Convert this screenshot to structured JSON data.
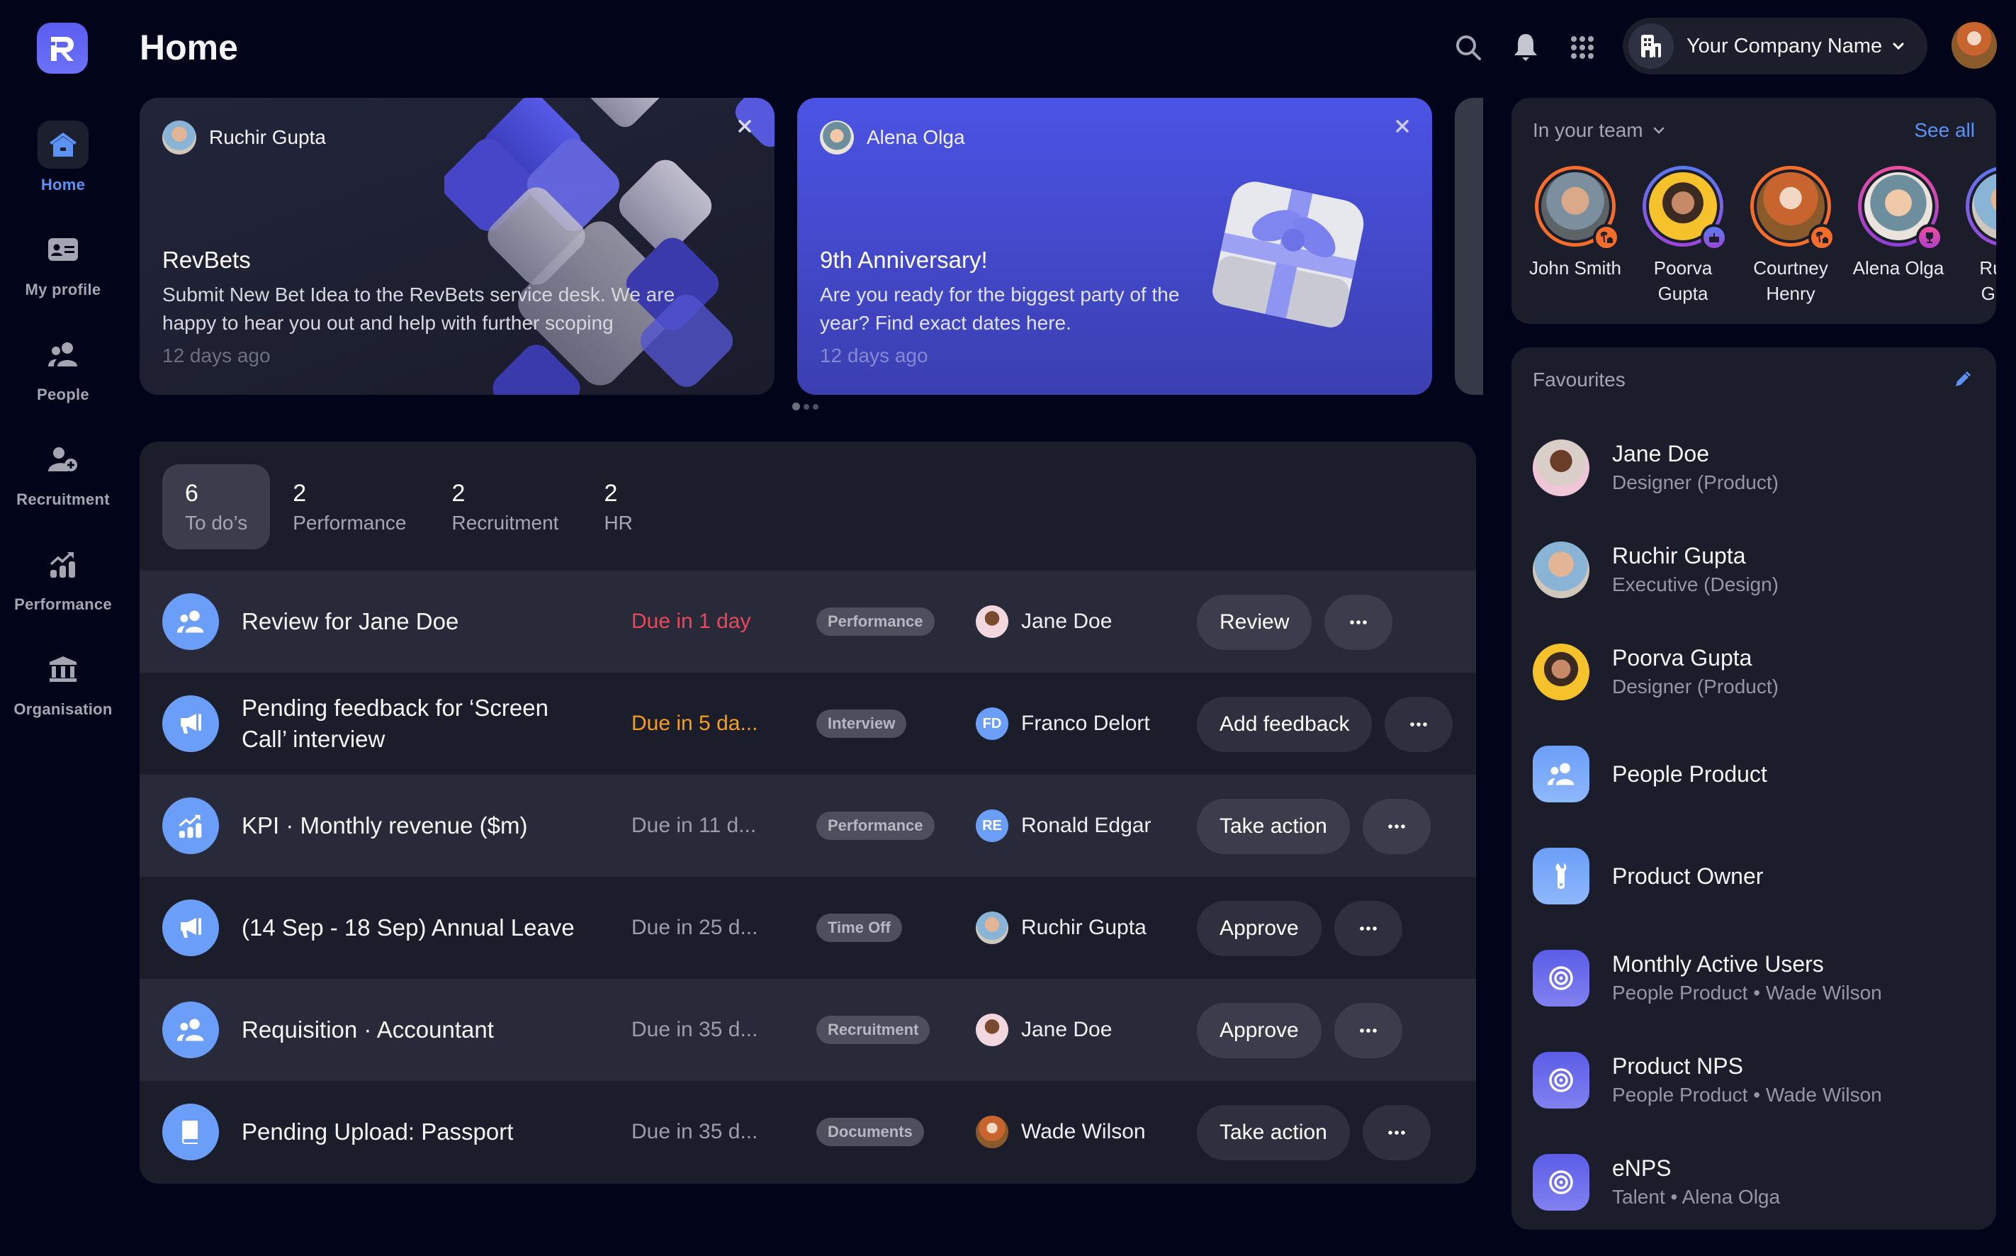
{
  "app": {
    "logo_letter": "R",
    "brand_color": "#5b5df0",
    "accent_color": "#5d92f5"
  },
  "sidebar": {
    "items": [
      {
        "label": "Home",
        "icon": "home-icon",
        "active": true
      },
      {
        "label": "My profile",
        "icon": "id-card-icon",
        "active": false
      },
      {
        "label": "People",
        "icon": "people-icon",
        "active": false
      },
      {
        "label": "Recruitment",
        "icon": "add-person-icon",
        "active": false
      },
      {
        "label": "Performance",
        "icon": "chart-growth-icon",
        "active": false
      },
      {
        "label": "Organisation",
        "icon": "bank-building-icon",
        "active": false
      }
    ]
  },
  "header": {
    "title": "Home",
    "icons": [
      "search-icon",
      "bell-icon",
      "apps-grid-icon"
    ],
    "company_name": "Your Company Name"
  },
  "announcements": [
    {
      "author": "Ruchir Gupta",
      "title": "RevBets",
      "body": "Submit New Bet Idea to the RevBets service desk. We are happy to hear you out and help with further scoping",
      "time": "12 days ago"
    },
    {
      "author": "Alena Olga",
      "title": "9th Anniversary!",
      "body": "Are you ready for the biggest party of the year? Find exact dates here.",
      "time": "12 days ago"
    }
  ],
  "carousel": {
    "page_count": 3,
    "active_index": 0
  },
  "tasks": {
    "tabs": [
      {
        "count": "6",
        "label": "To do’s",
        "active": true
      },
      {
        "count": "2",
        "label": "Performance",
        "active": false
      },
      {
        "count": "2",
        "label": "Recruitment",
        "active": false
      },
      {
        "count": "2",
        "label": "HR",
        "active": false
      }
    ],
    "rows": [
      {
        "icon": "people-icon",
        "title": "Review for Jane Doe",
        "due": "Due in 1 day",
        "due_status": "red",
        "tag": "Performance",
        "person": "Jane Doe",
        "person_initials": "",
        "action": "Review"
      },
      {
        "icon": "megaphone-icon",
        "title": "Pending feedback for ‘Screen Call’ interview",
        "due": "Due in 5 da...",
        "due_status": "orange",
        "tag": "Interview",
        "person": "Franco Delort",
        "person_initials": "FD",
        "action": "Add feedback"
      },
      {
        "icon": "chart-growth-icon",
        "title": "KPI · Monthly revenue ($m)",
        "due": "Due in 11 d...",
        "due_status": "normal",
        "tag": "Performance",
        "person": "Ronald Edgar",
        "person_initials": "RE",
        "action": "Take action"
      },
      {
        "icon": "megaphone-icon",
        "title": "(14 Sep - 18 Sep) Annual Leave",
        "due": "Due in 25 d...",
        "due_status": "normal",
        "tag": "Time Off",
        "person": "Ruchir Gupta",
        "person_initials": "",
        "action": "Approve"
      },
      {
        "icon": "people-icon",
        "title": "Requisition · Accountant",
        "due": "Due in 35 d...",
        "due_status": "normal",
        "tag": "Recruitment",
        "person": "Jane Doe",
        "person_initials": "",
        "action": "Approve"
      },
      {
        "icon": "book-icon",
        "title": "Pending Upload: Passport",
        "due": "Due in 35 d...",
        "due_status": "normal",
        "tag": "Documents",
        "person": "Wade Wilson",
        "person_initials": "",
        "action": "Take action"
      }
    ],
    "colors": {
      "red": "#e8485a",
      "orange": "#f59e1b"
    }
  },
  "team": {
    "heading": "In your team",
    "see_all": "See all",
    "members": [
      {
        "name": "John Smith",
        "badge": "vacation-icon"
      },
      {
        "name": "Poorva Gupta",
        "badge": "cake-icon"
      },
      {
        "name": "Courtney Henry",
        "badge": "vacation-icon"
      },
      {
        "name": "Alena Olga",
        "badge": "trophy-icon"
      },
      {
        "name": "Ruchir Gupta",
        "badge": ""
      }
    ]
  },
  "favourites": {
    "heading": "Favourites",
    "items": [
      {
        "type": "person",
        "name": "Jane Doe",
        "subtitle": "Designer (Product)"
      },
      {
        "type": "person",
        "name": "Ruchir Gupta",
        "subtitle": "Executive (Design)"
      },
      {
        "type": "person",
        "name": "Poorva Gupta",
        "subtitle": "Designer (Product)"
      },
      {
        "type": "team",
        "name": "People Product",
        "subtitle": "",
        "icon": "people-icon"
      },
      {
        "type": "role",
        "name": "Product Owner",
        "subtitle": "",
        "icon": "wrench-icon"
      },
      {
        "type": "goal",
        "name": "Monthly Active Users",
        "subtitle": "People Product • Wade Wilson",
        "icon": "target-icon"
      },
      {
        "type": "goal",
        "name": "Product NPS",
        "subtitle": "People Product • Wade Wilson",
        "icon": "target-icon"
      },
      {
        "type": "goal",
        "name": "eNPS",
        "subtitle": "Talent • Alena Olga",
        "icon": "target-icon"
      }
    ]
  }
}
